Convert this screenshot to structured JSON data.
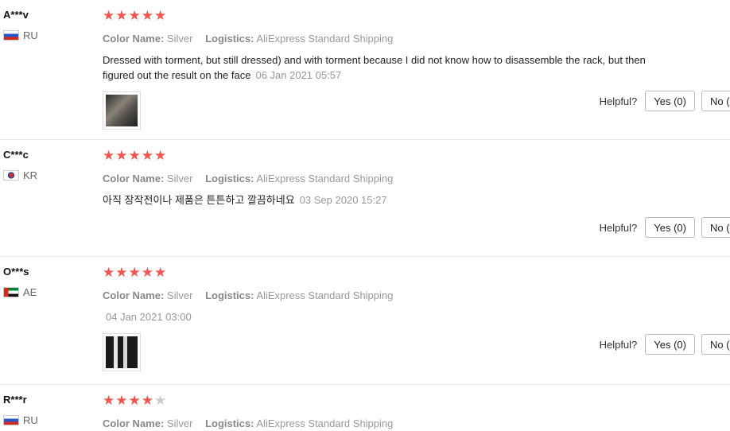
{
  "labels": {
    "color_key": "Color Name:",
    "logistics_key": "Logistics:",
    "helpful": "Helpful?",
    "yes": "Yes (0)",
    "no": "No ("
  },
  "reviews": [
    {
      "user": "A***v",
      "country": "RU",
      "rating": 5,
      "color": "Silver",
      "logistics": "AliExpress Standard Shipping",
      "text": "Dressed with torment, but still dressed) and with torment because I did not know how to disassemble the rack, but then figured out the result on the face",
      "date": "06 Jan 2021 05:57",
      "has_photo": true
    },
    {
      "user": "C***c",
      "country": "KR",
      "rating": 5,
      "color": "Silver",
      "logistics": "AliExpress Standard Shipping",
      "text": "아직 장작전이나 제품은 튼튼하고 깔끔하네요",
      "date": "03 Sep 2020 15:27",
      "has_photo": false
    },
    {
      "user": "O***s",
      "country": "AE",
      "rating": 5,
      "color": "Silver",
      "logistics": "AliExpress Standard Shipping",
      "text": "",
      "date": "04 Jan 2021 03:00",
      "has_photo": true
    },
    {
      "user": "R***r",
      "country": "RU",
      "rating": 4,
      "color": "Silver",
      "logistics": "AliExpress Standard Shipping",
      "text": "",
      "date": "",
      "has_photo": false
    }
  ],
  "colors": {
    "star_on": "#f0564d",
    "star_off": "#cccccc"
  }
}
